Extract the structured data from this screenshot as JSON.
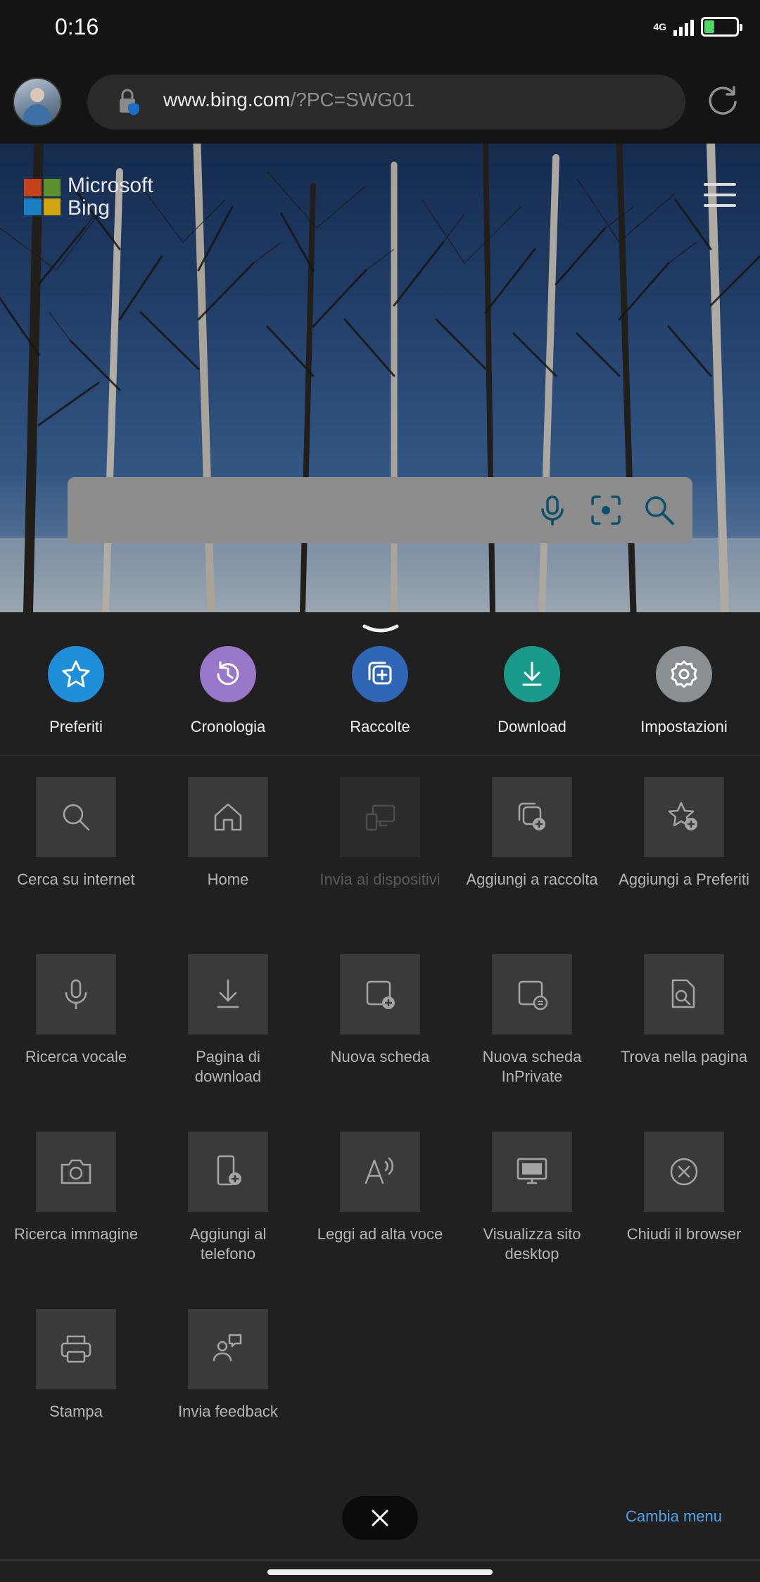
{
  "status_bar": {
    "time": "0:16",
    "network": "4G",
    "battery": "29"
  },
  "address_bar": {
    "url_host": "www.bing.com",
    "url_path": "/?PC=SWG01"
  },
  "hero": {
    "logo_line1": "Microsoft",
    "logo_line2": "Bing"
  },
  "quick_actions": [
    {
      "label": "Preferiti",
      "color": "#1e8fd8"
    },
    {
      "label": "Cronologia",
      "color": "#9a78c9"
    },
    {
      "label": "Raccolte",
      "color": "#2f66b5"
    },
    {
      "label": "Download",
      "color": "#1a9a8a"
    },
    {
      "label": "Impostazioni",
      "color": "#8a8f93"
    }
  ],
  "menu_rows": [
    [
      {
        "label": "Cerca su internet",
        "icon": "search-icon",
        "enabled": true
      },
      {
        "label": "Home",
        "icon": "home-icon",
        "enabled": true
      },
      {
        "label": "Invia ai dispositivi",
        "icon": "devices-icon",
        "enabled": false
      },
      {
        "label": "Aggiungi a raccolta",
        "icon": "add-collection-icon",
        "enabled": true
      },
      {
        "label": "Aggiungi a Preferiti",
        "icon": "add-favorite-icon",
        "enabled": true
      }
    ],
    [
      {
        "label": "Ricerca vocale",
        "icon": "microphone-icon",
        "enabled": true
      },
      {
        "label": "Pagina di download",
        "icon": "download-icon",
        "enabled": true
      },
      {
        "label": "Nuova scheda",
        "icon": "new-tab-icon",
        "enabled": true
      },
      {
        "label": "Nuova scheda InPrivate",
        "icon": "inprivate-tab-icon",
        "enabled": true
      },
      {
        "label": "Trova nella pagina",
        "icon": "find-in-page-icon",
        "enabled": true
      }
    ],
    [
      {
        "label": "Ricerca immagine",
        "icon": "camera-icon",
        "enabled": true
      },
      {
        "label": "Aggiungi al telefono",
        "icon": "add-to-phone-icon",
        "enabled": true
      },
      {
        "label": "Leggi ad alta voce",
        "icon": "read-aloud-icon",
        "enabled": true
      },
      {
        "label": "Visualizza sito desktop",
        "icon": "desktop-site-icon",
        "enabled": true
      },
      {
        "label": "Chiudi il browser",
        "icon": "close-circle-icon",
        "enabled": true
      }
    ],
    [
      {
        "label": "Stampa",
        "icon": "printer-icon",
        "enabled": true
      },
      {
        "label": "Invia feedback",
        "icon": "feedback-icon",
        "enabled": true
      }
    ]
  ],
  "footer": {
    "switch_menu": "Cambia menu"
  }
}
